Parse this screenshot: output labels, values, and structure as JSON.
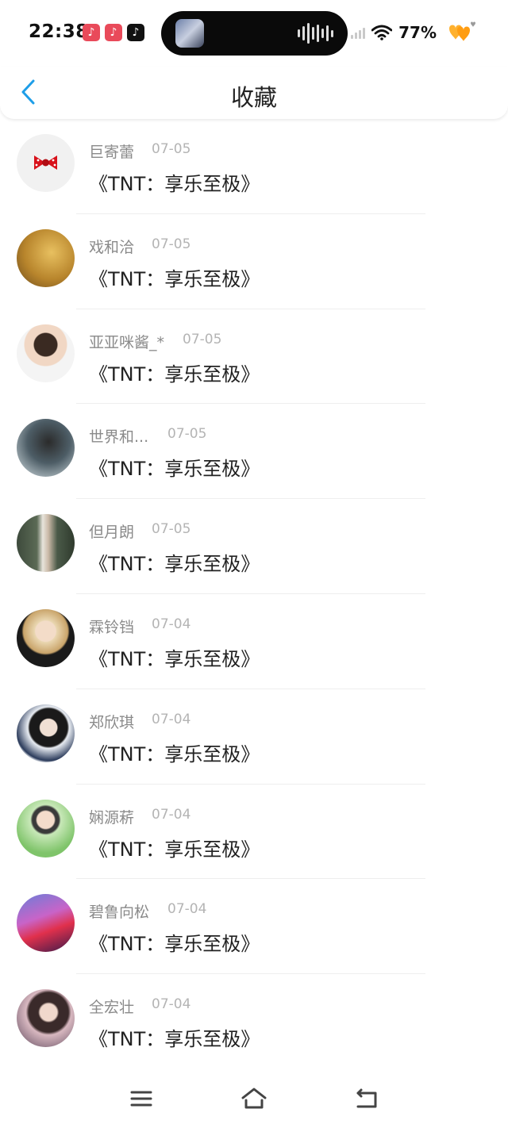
{
  "status_bar": {
    "time": "22:38",
    "battery": "77%",
    "notification_icons": [
      "app-red-icon",
      "app-red-icon",
      "tiktok-icon"
    ]
  },
  "header": {
    "title": "收藏",
    "back_icon": "chevron-left-icon"
  },
  "colors": {
    "accent": "#1e9ee8",
    "name_text": "#8a8a8a",
    "date_text": "#b4b4b4",
    "title_text": "#222222"
  },
  "items": [
    {
      "name": "巨寄蕾",
      "date": "07-05",
      "title": "《TNT：享乐至极》"
    },
    {
      "name": "戏和洽",
      "date": "07-05",
      "title": "《TNT：享乐至极》"
    },
    {
      "name": "亚亚咪酱_*",
      "date": "07-05",
      "title": "《TNT：享乐至极》"
    },
    {
      "name": "世界和...",
      "date": "07-05",
      "title": "《TNT：享乐至极》"
    },
    {
      "name": "但月朗",
      "date": "07-05",
      "title": "《TNT：享乐至极》"
    },
    {
      "name": "霖铃铛",
      "date": "07-04",
      "title": "《TNT：享乐至极》"
    },
    {
      "name": "郑欣琪",
      "date": "07-04",
      "title": "《TNT：享乐至极》"
    },
    {
      "name": "娴源菥",
      "date": "07-04",
      "title": "《TNT：享乐至极》"
    },
    {
      "name": "碧鲁向松",
      "date": "07-04",
      "title": "《TNT：享乐至极》"
    },
    {
      "name": "全宏壮",
      "date": "07-04",
      "title": "《TNT：享乐至极》"
    }
  ],
  "nav_bar": {
    "menu_icon": "menu-icon",
    "home_icon": "home-icon",
    "back_icon": "back-icon"
  }
}
